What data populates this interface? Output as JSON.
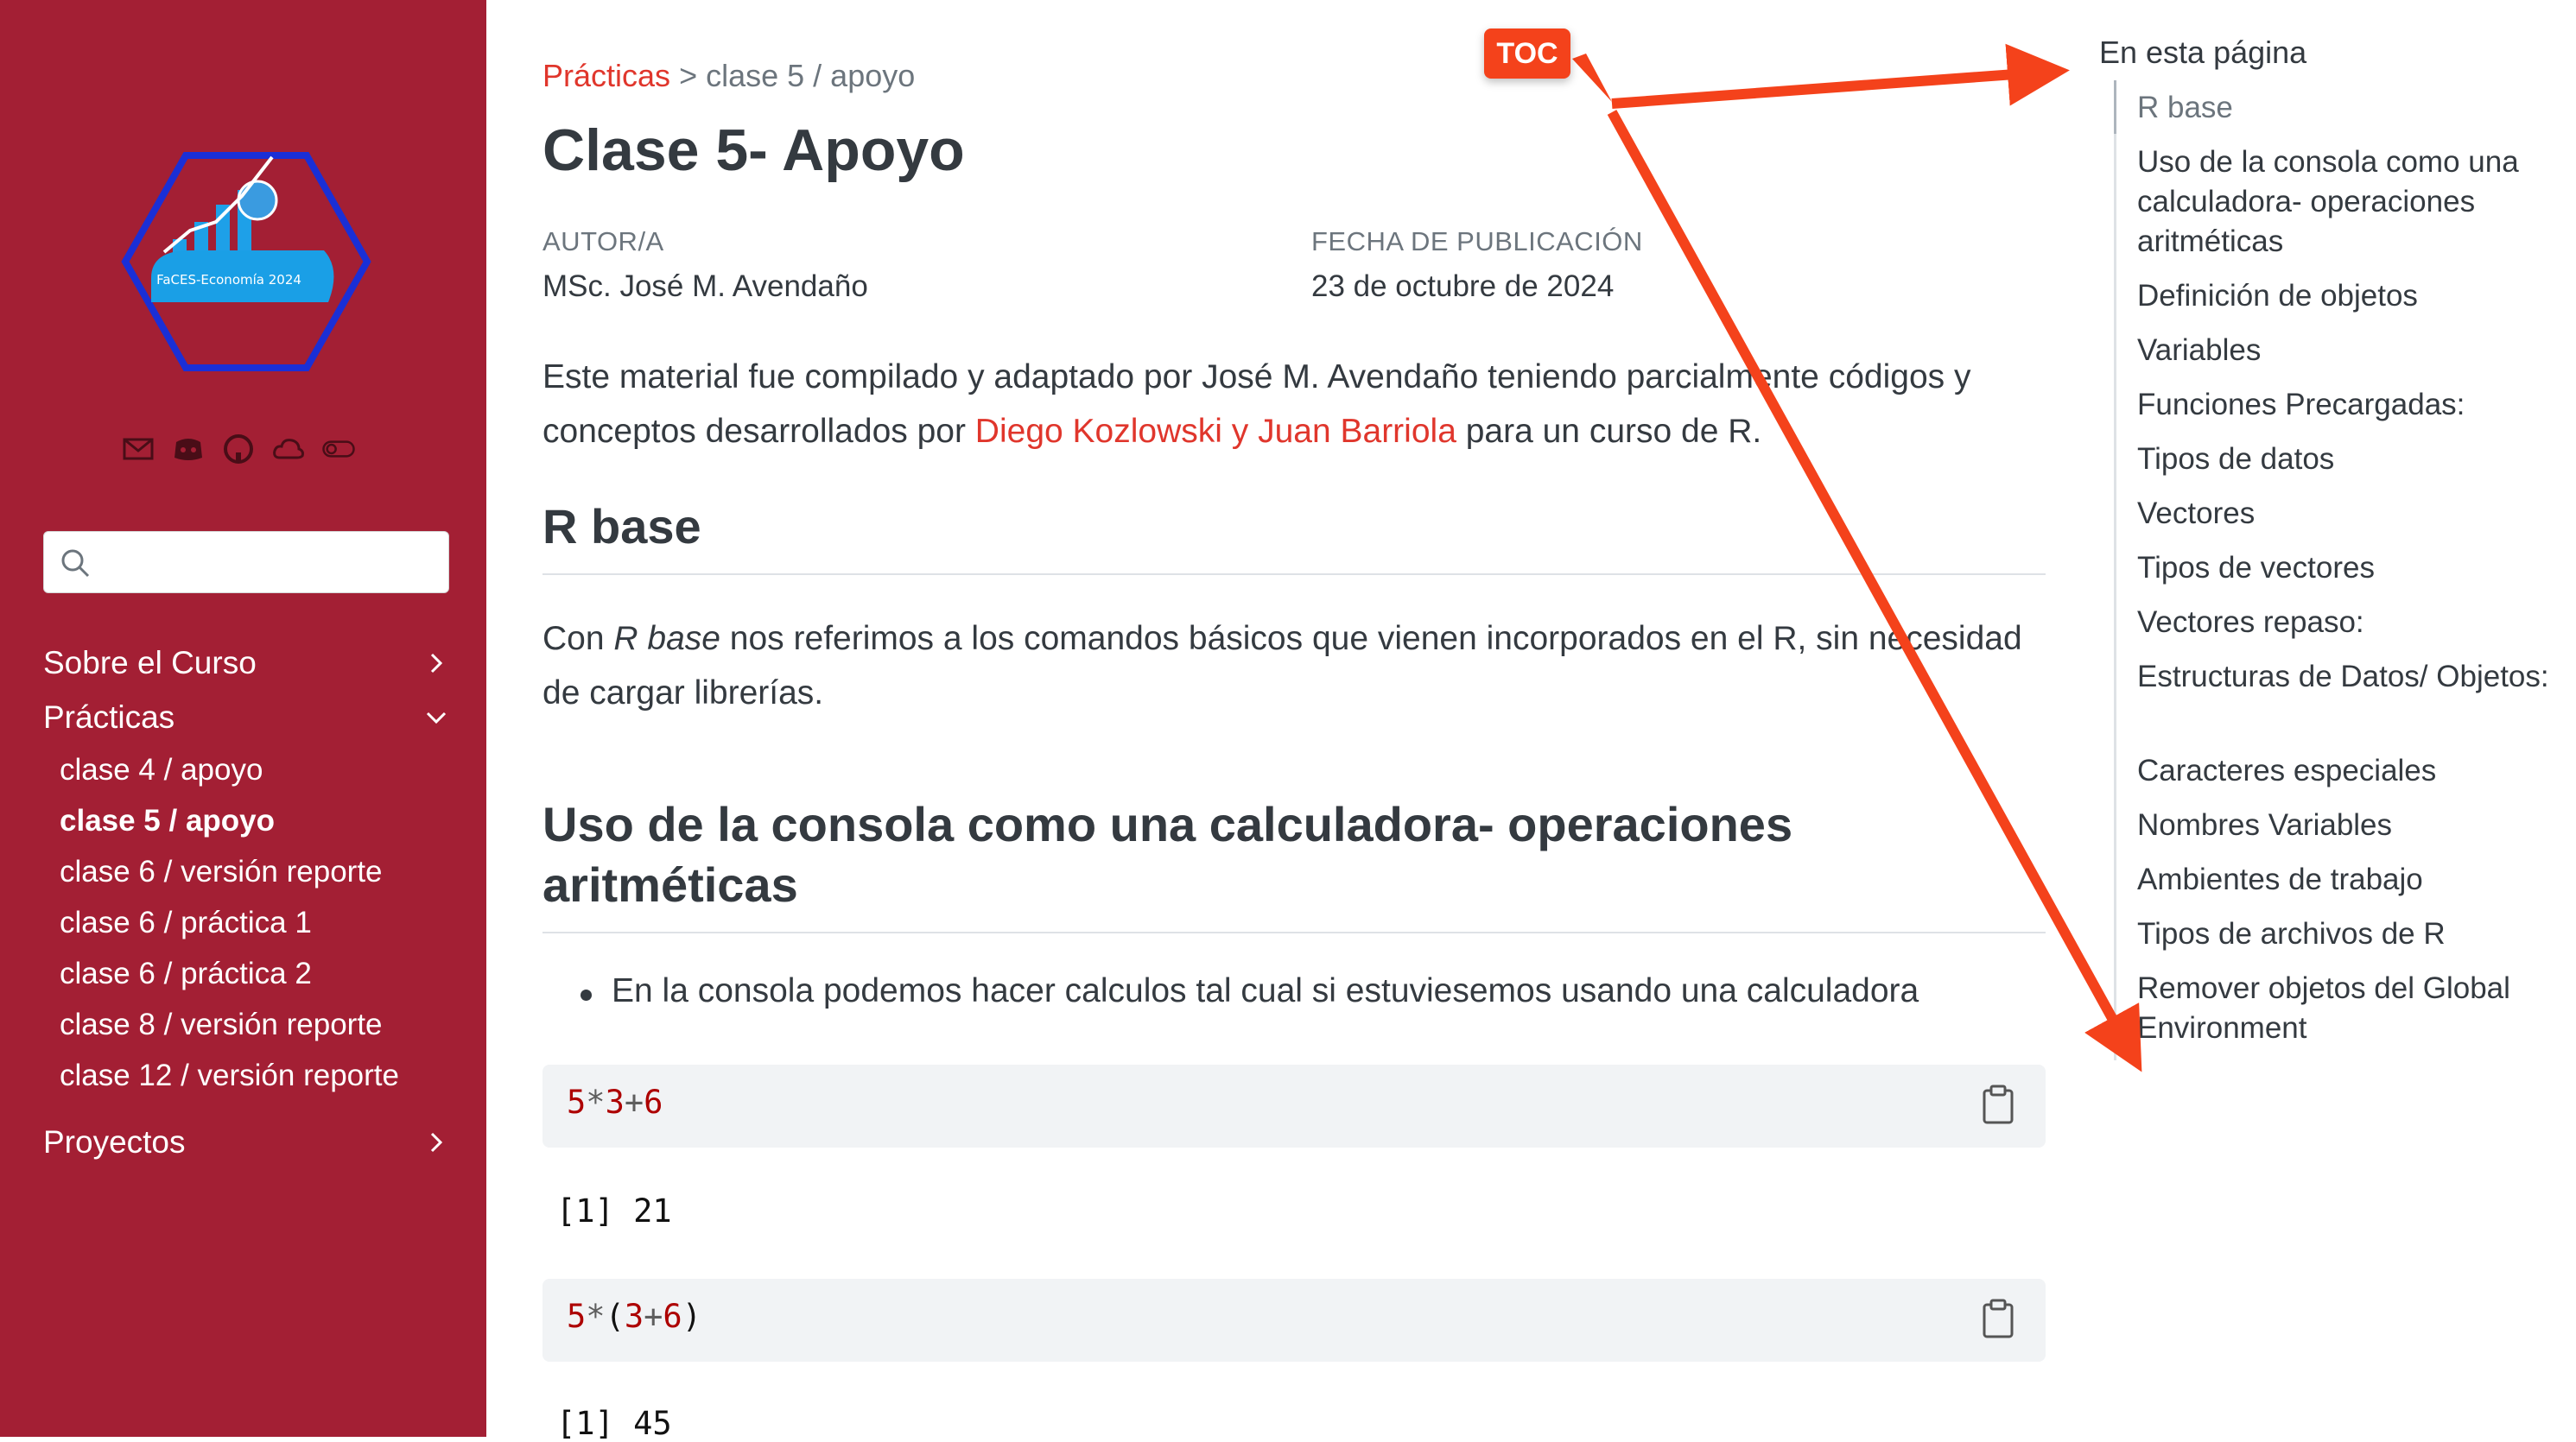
{
  "sidebar": {
    "logo_text": "FaCES-Economía 2024",
    "social_icons": [
      "mail-icon",
      "discord-icon",
      "github-icon",
      "cloud-icon",
      "toggle-icon"
    ],
    "search": {
      "placeholder": "",
      "value": ""
    },
    "sections": [
      {
        "label": "Sobre el Curso",
        "expanded": false
      },
      {
        "label": "Prácticas",
        "expanded": true
      },
      {
        "label": "Proyectos",
        "expanded": false
      }
    ],
    "practicas_items": [
      {
        "label": "clase 4 / apoyo",
        "active": false
      },
      {
        "label": "clase 5 / apoyo",
        "active": true
      },
      {
        "label": "clase 6 / versión reporte",
        "active": false
      },
      {
        "label": "clase 6 / práctica 1",
        "active": false
      },
      {
        "label": "clase 6 / práctica 2",
        "active": false
      },
      {
        "label": "clase 8 / versión reporte",
        "active": false
      },
      {
        "label": "clase 12 / versión reporte",
        "active": false
      }
    ],
    "colors": {
      "background": "#a31f34"
    }
  },
  "main": {
    "breadcrumb": {
      "parent": "Prácticas",
      "separator": ">",
      "current": "clase 5 / apoyo"
    },
    "title": "Clase 5- Apoyo",
    "author_label": "AUTOR/A",
    "author": "MSc. José M. Avendaño",
    "date_label": "FECHA DE PUBLICACIÓN",
    "date": "23 de octubre de 2024",
    "intro_part1": "Este material fue compilado y adaptado por José M. Avendaño teniendo parcialmente códigos y conceptos desarrollados por ",
    "intro_link": "Diego Kozlowski y Juan Barriola",
    "intro_part2": " para un curso de R.",
    "section1_title": "R base",
    "section1_text_pre": "Con ",
    "section1_text_em": "R base",
    "section1_text_post": " nos referimos a los comandos básicos que vienen incorporados en el R, sin necesidad de cargar librerías.",
    "section2_title": "Uso de la consola como una calculadora- operaciones aritméticas",
    "bullet1": "En la consola podemos hacer calculos tal cual si estuviesemos usando una calculadora",
    "code_blocks": [
      {
        "code": "5*3+6",
        "output": "[1] 21"
      },
      {
        "code": "5*(3+6)",
        "output": "[1] 45"
      }
    ],
    "colors": {
      "link": "#e0362c",
      "code_bg": "#f1f3f5"
    }
  },
  "toc": {
    "title": "En esta página",
    "items": [
      {
        "label": "R base",
        "active": true
      },
      {
        "label": "Uso de la consola como una calculadora- operaciones aritméticas",
        "active": false
      },
      {
        "label": "Definición de objetos",
        "active": false
      },
      {
        "label": "Variables",
        "active": false
      },
      {
        "label": "Funciones Precargadas:",
        "active": false
      },
      {
        "label": "Tipos de datos",
        "active": false
      },
      {
        "label": "Vectores",
        "active": false
      },
      {
        "label": "Tipos de vectores",
        "active": false
      },
      {
        "label": "Vectores repaso:",
        "active": false
      },
      {
        "label": "Estructuras de Datos/ Objetos:",
        "active": false
      },
      {
        "label": "Caracteres especiales",
        "active": false
      },
      {
        "label": "Nombres Variables",
        "active": false
      },
      {
        "label": "Ambientes de trabajo",
        "active": false
      },
      {
        "label": "Tipos de archivos de R",
        "active": false
      },
      {
        "label": "Remover objetos del Global Environment",
        "active": false
      }
    ]
  },
  "annotation": {
    "badge": "TOC",
    "color": "#f4421b"
  }
}
